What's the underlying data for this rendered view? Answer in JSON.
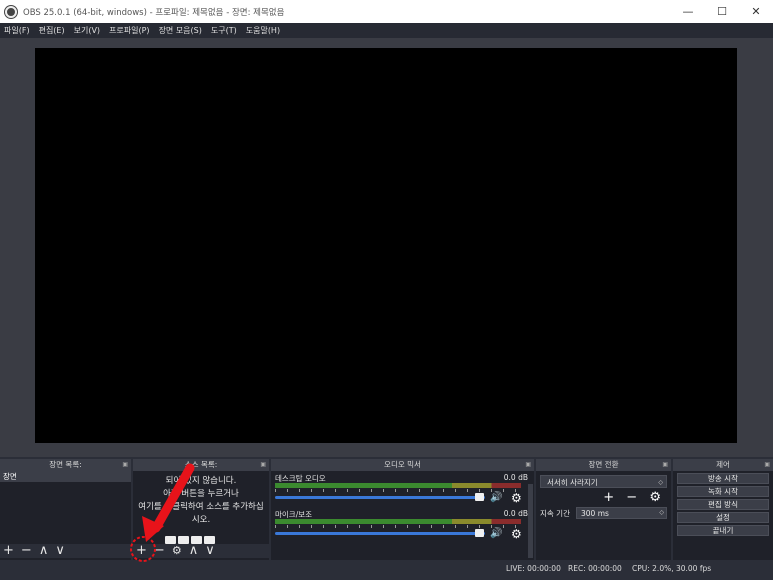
{
  "window": {
    "title": "OBS 25.0.1 (64-bit, windows) - 프로파일: 제목없음 - 장면: 제목없음",
    "minimize": "—",
    "maximize": "☐",
    "close": "✕"
  },
  "menu": {
    "items": [
      "파일(F)",
      "편집(E)",
      "보기(V)",
      "프로파일(P)",
      "장면 모음(S)",
      "도구(T)",
      "도움말(H)"
    ]
  },
  "docks": {
    "scenes": {
      "title": "장면 목록:",
      "items": [
        "장면"
      ],
      "toolbar": [
        "+",
        "−",
        "∧",
        "∨"
      ]
    },
    "sources": {
      "title": "소스 목록:",
      "empty_lines": [
        "되어 있지 않습니다.",
        "아래 버튼을 누르거나",
        "여기를 우클릭하여 소스를 추가하십",
        "시오."
      ],
      "toolbar": [
        "+",
        "−",
        "⚙",
        "∧",
        "∨"
      ]
    },
    "mixer": {
      "title": "오디오 믹서",
      "tracks": [
        {
          "name": "데스크탑 오디오",
          "db": "0.0 dB"
        },
        {
          "name": "마이크/보조",
          "db": "0.0 dB"
        }
      ]
    },
    "transitions": {
      "title": "장면 전환",
      "selected": "서서히 사라지기",
      "duration_label": "지속 기간",
      "duration_value": "300 ms",
      "tools": "+ − ⚙"
    },
    "controls": {
      "title": "제어",
      "buttons": [
        "방송 시작",
        "녹화 시작",
        "편집 방식",
        "설정",
        "끝내기"
      ]
    }
  },
  "status": {
    "live": "LIVE: 00:00:00",
    "rec": "REC: 00:00:00",
    "cpu": "CPU: 2.0%, 30.00 fps"
  },
  "colors": {
    "annotation": "#e8131a",
    "fader": "#3a78d8"
  }
}
